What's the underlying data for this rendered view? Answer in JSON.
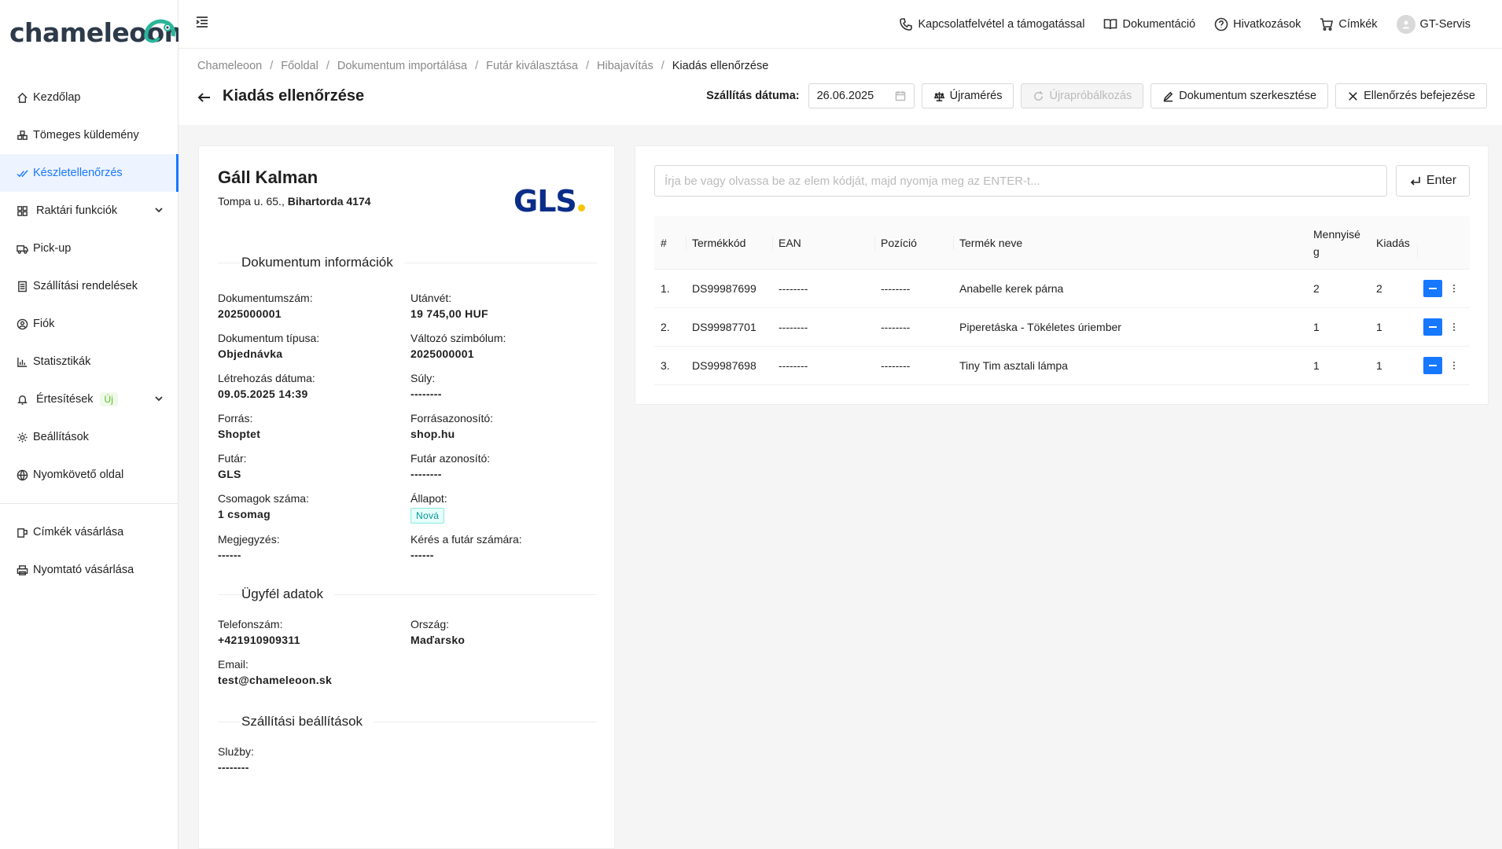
{
  "brand": {
    "name": "chameleoon",
    "accent": "#1677ff"
  },
  "sidebar": {
    "items": [
      {
        "label": "Kezdőlap",
        "icon": "home-icon"
      },
      {
        "label": "Tömeges küldemény",
        "icon": "boxes-icon"
      },
      {
        "label": "Készletellenőrzés",
        "icon": "check-double-icon",
        "active": true
      },
      {
        "label": "Raktári funkciók",
        "icon": "grid-icon",
        "expandable": true
      },
      {
        "label": "Pick-up",
        "icon": "truck-icon"
      },
      {
        "label": "Szállítási rendelések",
        "icon": "list-icon"
      },
      {
        "label": "Fiók",
        "icon": "user-circle-icon"
      },
      {
        "label": "Statisztikák",
        "icon": "bar-chart-icon"
      },
      {
        "label": "Értesítések",
        "icon": "bell-icon",
        "badge": "Új",
        "expandable": true
      },
      {
        "label": "Beállítások",
        "icon": "gear-icon"
      },
      {
        "label": "Nyomkövető oldal",
        "icon": "globe-icon"
      }
    ],
    "extra": [
      {
        "label": "Címkék vásárlása",
        "icon": "label-roll-icon"
      },
      {
        "label": "Nyomtató vásárlása",
        "icon": "printer-icon"
      }
    ]
  },
  "topbar": {
    "support": "Kapcsolatfelvétel a támogatással",
    "docs": "Dokumentáció",
    "refs": "Hivatkozások",
    "labels": "Címkék",
    "user": "GT-Servis"
  },
  "breadcrumb": [
    "Chameleoon",
    "Főoldal",
    "Dokumentum importálása",
    "Futár kiválasztása",
    "Hibajavítás",
    "Kiadás ellenőrzése"
  ],
  "page": {
    "title": "Kiadás ellenőrzése",
    "date_label": "Szállítás dátuma:",
    "date_value": "26.06.2025",
    "btn_remeasure": "Újramérés",
    "btn_retry": "Újrapróbálkozás",
    "btn_edit": "Dokumentum szerkesztése",
    "btn_finish": "Ellenőrzés befejezése"
  },
  "customer": {
    "name": "Gáll Kalman",
    "street": "Tompa u. 65.,",
    "city": "Bihartorda 4174",
    "carrier_logo": "GLS"
  },
  "doc_info": {
    "title": "Dokumentum információk",
    "fields": [
      {
        "label": "Dokumentumszám:",
        "value": "2025000001"
      },
      {
        "label": "Utánvét:",
        "value": "19 745,00 HUF"
      },
      {
        "label": "Dokumentum típusa:",
        "value": "Objednávka"
      },
      {
        "label": "Változó szimbólum:",
        "value": "2025000001"
      },
      {
        "label": "Létrehozás dátuma:",
        "value": "09.05.2025 14:39"
      },
      {
        "label": "Súly:",
        "value": "--------"
      },
      {
        "label": "Forrás:",
        "value": "Shoptet"
      },
      {
        "label": "Forrásazonosító:",
        "value": "shop.hu"
      },
      {
        "label": "Futár:",
        "value": "GLS"
      },
      {
        "label": "Futár azonosító:",
        "value": "--------"
      },
      {
        "label": "Csomagok száma:",
        "value": "1 csomag"
      },
      {
        "label": "Állapot:",
        "value": "Nová"
      },
      {
        "label": "Megjegyzés:",
        "value": "------"
      },
      {
        "label": "Kérés a futár számára:",
        "value": "------"
      }
    ]
  },
  "client_info": {
    "title": "Ügyfél adatok",
    "fields": [
      {
        "label": "Telefonszám:",
        "value": "+421910909311"
      },
      {
        "label": "Ország:",
        "value": "Maďarsko"
      },
      {
        "label": "Email:",
        "value": "test@chameleoon.sk"
      }
    ]
  },
  "shipping": {
    "title": "Szállítási beállítások",
    "fields": [
      {
        "label": "Služby:",
        "value": "--------"
      }
    ]
  },
  "scan": {
    "placeholder": "Írja be vagy olvassa be az elem kódját, majd nyomja meg az ENTER-t...",
    "enter_label": "Enter"
  },
  "table": {
    "headers": [
      "#",
      "Termékkód",
      "EAN",
      "Pozíció",
      "Termék neve",
      "Mennyiség",
      "Kiadás"
    ],
    "rows": [
      {
        "n": "1.",
        "code": "DS99987699",
        "ean": "--------",
        "pos": "--------",
        "name": "Anabelle kerek párna",
        "qty": "2",
        "out": "2"
      },
      {
        "n": "2.",
        "code": "DS99987701",
        "ean": "--------",
        "pos": "--------",
        "name": "Piperetáska - Tökéletes úriember",
        "qty": "1",
        "out": "1"
      },
      {
        "n": "3.",
        "code": "DS99987698",
        "ean": "--------",
        "pos": "--------",
        "name": "Tiny Tim asztali lámpa",
        "qty": "1",
        "out": "1"
      }
    ]
  }
}
